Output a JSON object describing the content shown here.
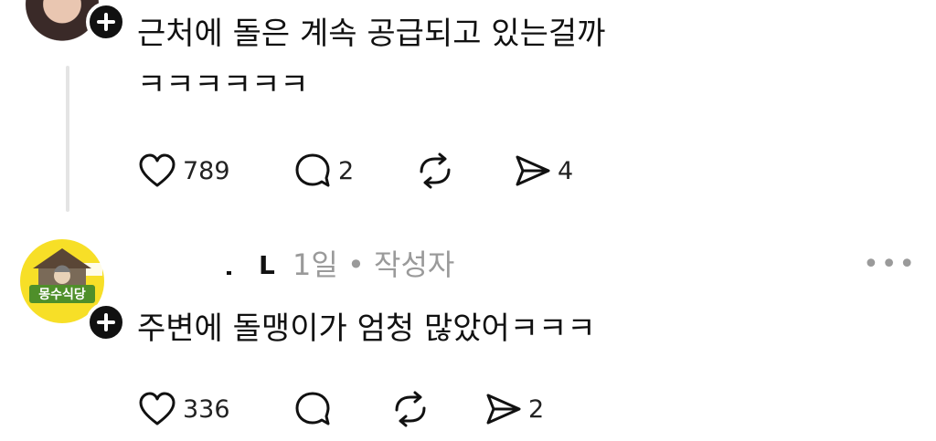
{
  "post1": {
    "line1": "근처에 돌은 계속 공급되고 있는걸까",
    "line2": "ㅋㅋㅋㅋㅋㅋ",
    "likes": "789",
    "replies": "2",
    "shares": "4"
  },
  "post2": {
    "author_initial": "L",
    "meta": "1일 • 작성자",
    "more": "•••",
    "avatar_sign": "몽수식당",
    "text": "주변에 돌맹이가 엄청 많았어ㅋㅋㅋ",
    "likes": "336",
    "shares": "2"
  },
  "colors": {
    "text": "#111111",
    "muted": "#9a9a9a",
    "thread_line": "#e4e4e4",
    "avatar_yellow": "#f7df27",
    "sign_green": "#4f8f2a"
  },
  "icons": [
    "plus-icon",
    "heart-icon",
    "comment-icon",
    "repost-icon",
    "share-icon",
    "more-icon"
  ]
}
